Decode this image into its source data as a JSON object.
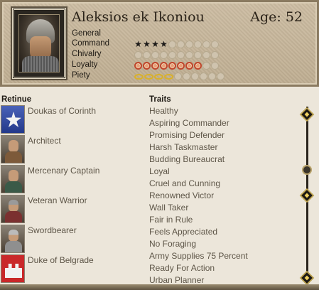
{
  "character": {
    "name": "Aleksios ek Ikoniou",
    "age": "Age: 52",
    "rank": "General"
  },
  "stats": [
    {
      "label": "Command",
      "filled": 4,
      "total": 10,
      "style": "star"
    },
    {
      "label": "Chivalry",
      "filled": 0,
      "total": 10,
      "style": "none"
    },
    {
      "label": "Loyalty",
      "filled": 8,
      "total": 10,
      "style": "ring"
    },
    {
      "label": "Piety",
      "filled": 4,
      "total": 10,
      "style": "halo"
    }
  ],
  "retinue": {
    "header": "Retinue",
    "items": [
      {
        "label": "Doukas of Corinth",
        "icon": "corinth-emblem-icon"
      },
      {
        "label": "Architect",
        "icon": "architect-portrait-icon"
      },
      {
        "label": "Mercenary Captain",
        "icon": "mercenary-portrait-icon"
      },
      {
        "label": "Veteran Warrior",
        "icon": "veteran-portrait-icon"
      },
      {
        "label": "Swordbearer",
        "icon": "swordbearer-portrait-icon"
      },
      {
        "label": "Duke of Belgrade",
        "icon": "belgrade-emblem-icon"
      }
    ]
  },
  "traits": {
    "header": "Traits",
    "items": [
      "Healthy",
      "Aspiring Commander",
      "Promising Defender",
      "Harsh Taskmaster",
      "Budding Bureaucrat",
      "Loyal",
      "Cruel and Cunning",
      "Renowned Victor",
      "Wall Taker",
      "Fair in Rule",
      "Feels Appreciated",
      "No Foraging",
      "Army Supplies 75 Percent",
      "Ready For Action",
      "Urban Planner"
    ]
  },
  "colors": {
    "accent": "#c0462c",
    "halo": "#d9b12a",
    "text_muted": "#5e5648"
  }
}
